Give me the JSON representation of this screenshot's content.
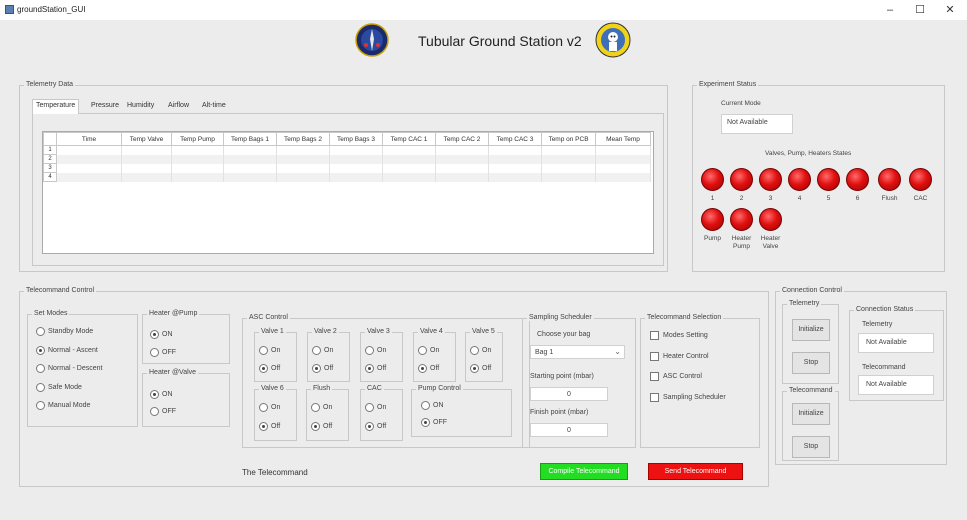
{
  "window": {
    "title": "groundStation_GUI",
    "minimize": "–",
    "maximize": "☐",
    "close": "✕"
  },
  "header": {
    "title": "Tubular Ground Station v2"
  },
  "telemetry": {
    "legend": "Telemetry Data",
    "tabs": [
      "Temperature",
      "Pressure",
      "Humidity",
      "Airflow",
      "Alt-time"
    ],
    "columns": [
      "",
      "Time",
      "Temp Valve",
      "Temp Pump",
      "Temp Bags 1",
      "Temp Bags 2",
      "Temp Bags 3",
      "Temp CAC 1",
      "Temp CAC 2",
      "Temp CAC 3",
      "Temp on PCB",
      "Mean Temp"
    ],
    "rows": [
      "1",
      "2",
      "3",
      "4"
    ]
  },
  "experiment": {
    "legend": "Experiment Status",
    "current_mode_label": "Current Mode",
    "current_mode_value": "Not Available",
    "states_label": "Valves, Pump, Heaters States",
    "leds_row1": [
      "1",
      "2",
      "3",
      "4",
      "5",
      "6",
      "Flush",
      "CAC"
    ],
    "leds_row2": [
      "Pump",
      "Heater\nPump",
      "Heater\nValve"
    ]
  },
  "telecommand": {
    "legend": "Telecommand Control",
    "set_modes": {
      "legend": "Set Modes",
      "options": [
        "Standby Mode",
        "Normal - Ascent",
        "Normal - Descent",
        "Safe Mode",
        "Manual Mode"
      ],
      "selected": 1
    },
    "heater_pump": {
      "legend": "Heater @Pump",
      "on": "ON",
      "off": "OFF"
    },
    "heater_valve": {
      "legend": "Heater @Valve",
      "on": "ON",
      "off": "OFF"
    },
    "asc": {
      "legend": "ASC Control",
      "valves": [
        "Valve 1",
        "Valve 2",
        "Valve 3",
        "Valve 4",
        "Valve 5"
      ],
      "valve6": "Valve 6",
      "flush": "Flush",
      "cac": "CAC",
      "pump": "Pump Control",
      "on": "On",
      "off": "Off",
      "pump_on": "ON",
      "pump_off": "OFF"
    },
    "sampling": {
      "legend": "Sampling Scheduler",
      "choose_label": "Choose your bag",
      "bag_value": "Bag 1",
      "start_label": "Starting point (mbar)",
      "start_value": "0",
      "finish_label": "Finish point (mbar)",
      "finish_value": "0"
    },
    "selection": {
      "legend": "Telecommand Selection",
      "items": [
        "Modes Setting",
        "Heater Control",
        "ASC Control",
        "Sampling Scheduler"
      ]
    },
    "preview_label": "The Telecommand",
    "compile_label": "Compile Telecommand",
    "send_label": "Send Telecommand",
    "compile_color": "#22dd22",
    "send_color": "#ee1111"
  },
  "connection": {
    "legend": "Connection Control",
    "telemetry_legend": "Telemetry",
    "telecommand_legend": "Telecommand",
    "initialize": "Initialize",
    "stop": "Stop",
    "status_legend": "Connection Status",
    "telemetry_label": "Telemetry",
    "telemetry_value": "Not Available",
    "telecommand_label": "Telecommand",
    "telecommand_value": "Not Available"
  }
}
